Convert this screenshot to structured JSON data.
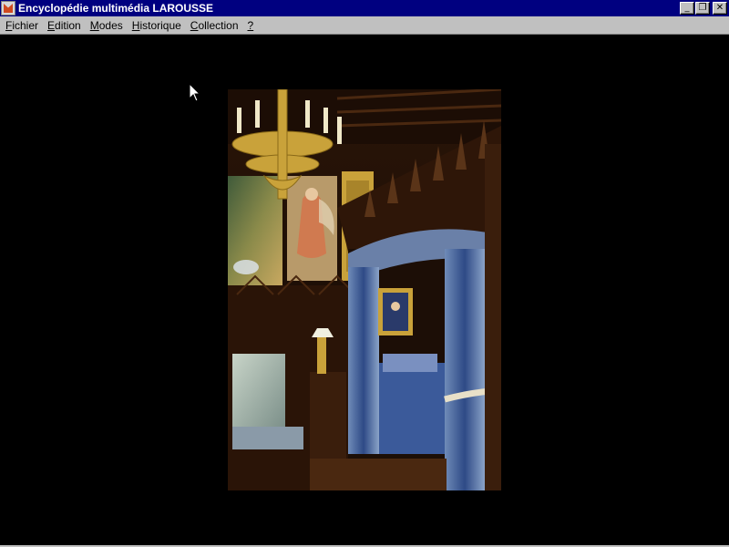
{
  "window": {
    "title": "Encyclopédie multimédia LAROUSSE",
    "icon": "larousse-app-icon",
    "controls": {
      "minimize": "_",
      "restore": "❐",
      "close": "✕"
    }
  },
  "menu": {
    "items": [
      {
        "accel": "F",
        "rest": "ichier"
      },
      {
        "accel": "E",
        "rest": "dition"
      },
      {
        "accel": "M",
        "rest": "odes"
      },
      {
        "accel": "H",
        "rest": "istorique"
      },
      {
        "accel": "C",
        "rest": "ollection"
      },
      {
        "accel": "?",
        "rest": ""
      }
    ]
  },
  "photo": {
    "subject": "bedroom-interior-photograph",
    "colors": {
      "wood": "#3a1e0c",
      "gold": "#c9a23a",
      "blue_drape": "#3b5a9a",
      "background": "#000000"
    }
  }
}
